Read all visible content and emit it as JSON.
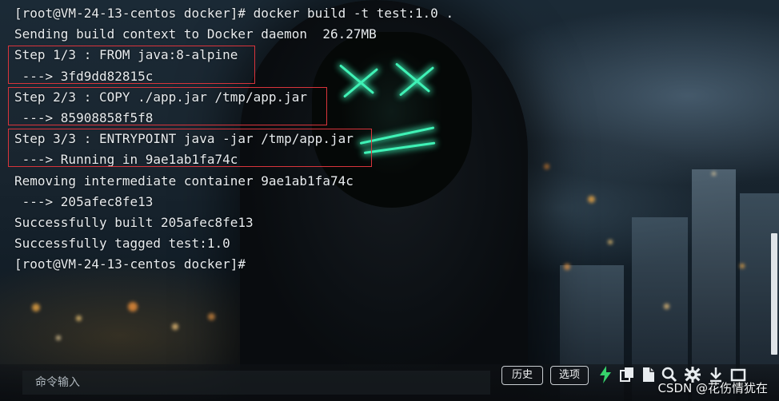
{
  "terminal": {
    "lines": [
      "[root@VM-24-13-centos docker]# docker build -t test:1.0 .",
      "Sending build context to Docker daemon  26.27MB",
      "Step 1/3 : FROM java:8-alpine",
      " ---> 3fd9dd82815c",
      "Step 2/3 : COPY ./app.jar /tmp/app.jar",
      " ---> 85908858f5f8",
      "Step 3/3 : ENTRYPOINT java -jar /tmp/app.jar",
      " ---> Running in 9ae1ab1fa74c",
      "Removing intermediate container 9ae1ab1fa74c",
      " ---> 205afec8fe13",
      "Successfully built 205afec8fe13",
      "Successfully tagged test:1.0",
      "[root@VM-24-13-centos docker]#"
    ],
    "highlight_color": "#d9343b"
  },
  "command_bar": {
    "input_placeholder": "命令输入",
    "history_label": "历史",
    "options_label": "选项",
    "icons": [
      "lightning-icon",
      "copy-icon",
      "file-icon",
      "search-icon",
      "gear-icon",
      "download-icon",
      "fullscreen-icon"
    ],
    "accent_color": "#36d26b"
  },
  "watermark": "CSDN @花伤情犹在"
}
